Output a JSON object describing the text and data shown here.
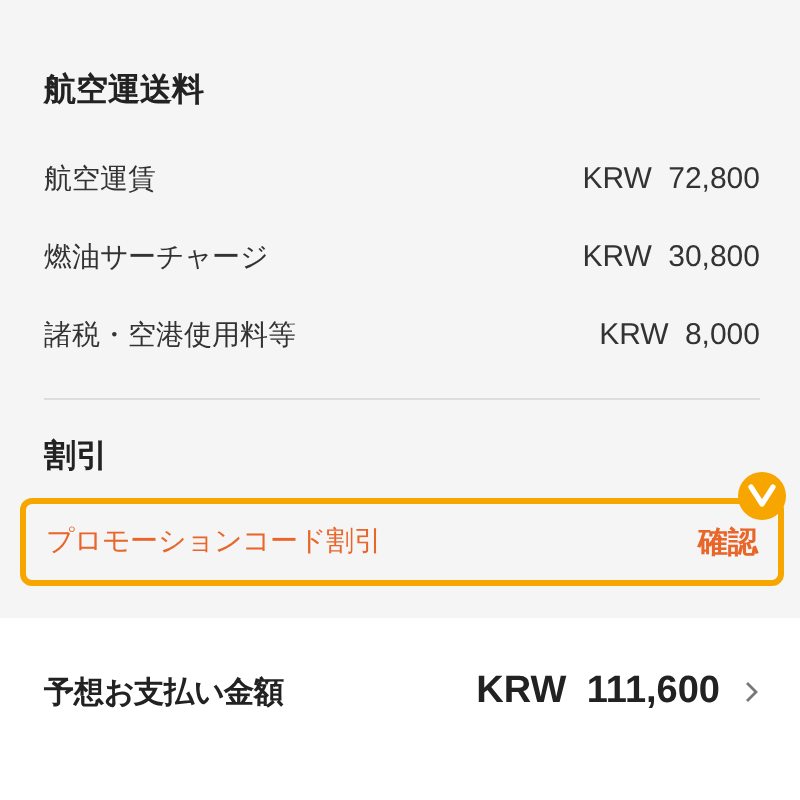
{
  "fare_section": {
    "title": "航空運送料",
    "rows": [
      {
        "label": "航空運賃",
        "amount": "KRW 72,800"
      },
      {
        "label": "燃油サーチャージ",
        "amount": "KRW 30,800"
      },
      {
        "label": "諸税・空港使用料等",
        "amount": "KRW 8,000"
      }
    ]
  },
  "discount_section": {
    "title": "割引",
    "promo": {
      "label": "プロモーションコード割引",
      "action": "確認",
      "highlighted": true
    }
  },
  "total": {
    "label": "予想お支払い金額",
    "amount": "KRW 111,600"
  }
}
